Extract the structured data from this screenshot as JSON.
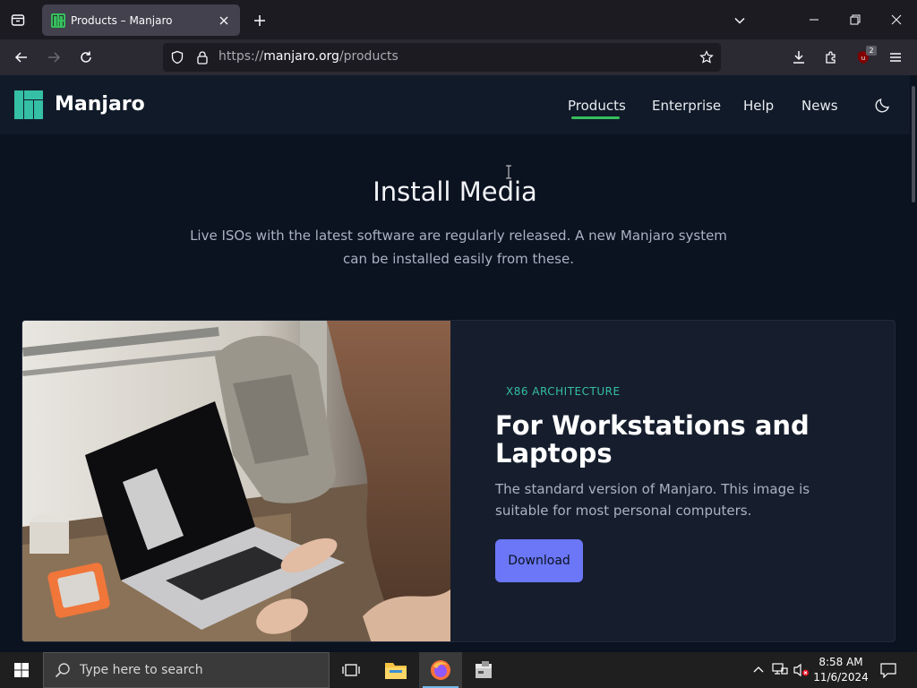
{
  "browser": {
    "tab": {
      "title": "Products – Manjaro"
    },
    "url": {
      "host_prefix": "https://",
      "host": "manjaro.org",
      "path": "/products"
    },
    "extensions_badge": "2"
  },
  "site": {
    "name": "Manjaro",
    "brand_color": "#35bf5c",
    "nav": {
      "products": "Products",
      "enterprise": "Enterprise",
      "help": "Help",
      "news": "News"
    }
  },
  "hero": {
    "title": "Install Media",
    "description": "Live ISOs with the latest software are regularly released. A new Manjaro system can be installed easily from these."
  },
  "product": {
    "architecture": "X86 ARCHITECTURE",
    "heading": "For Workstations and Laptops",
    "description": "The standard version of Manjaro. This image is suitable for most personal computers.",
    "download_label": "Download",
    "accent_color": "#6b77f7"
  },
  "taskbar": {
    "search_placeholder": "Type here to search",
    "time": "8:58 AM",
    "date": "11/6/2024"
  }
}
